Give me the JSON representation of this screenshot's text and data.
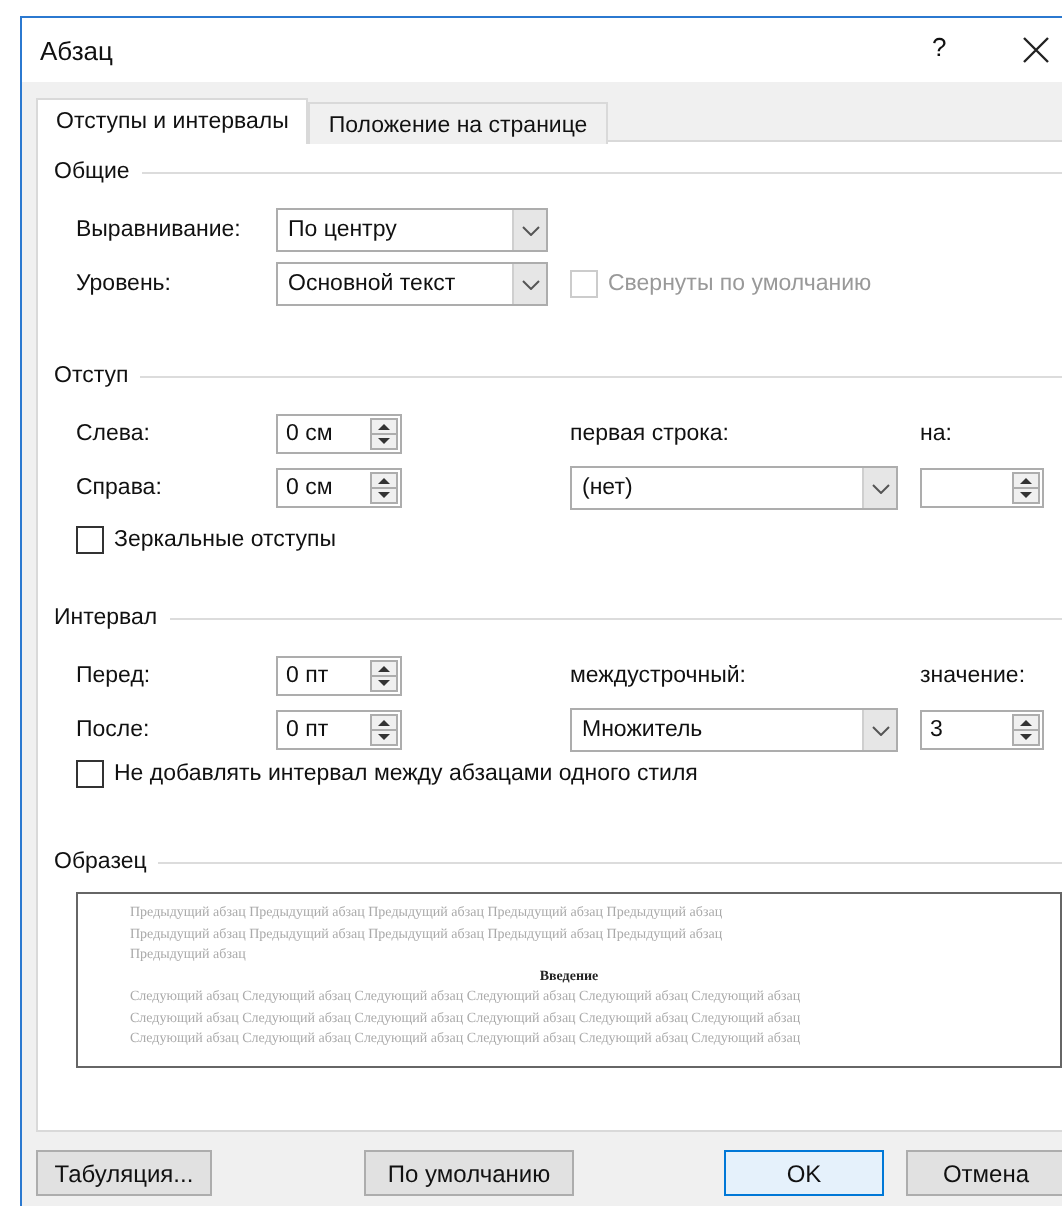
{
  "window": {
    "title": "Абзац",
    "help": "?"
  },
  "tabs": [
    {
      "label": "Отступы и интервалы",
      "selected": true
    },
    {
      "label": "Положение на странице",
      "selected": false
    }
  ],
  "general": {
    "title": "Общие",
    "alignment": {
      "label": "Выравнивание:",
      "value": "По центру"
    },
    "level": {
      "label": "Уровень:",
      "value": "Основной текст"
    },
    "collapsed": {
      "label": "Свернуты по умолчанию",
      "checked": false,
      "disabled": true
    }
  },
  "indent": {
    "title": "Отступ",
    "left": {
      "label": "Слева:",
      "value": "0 см"
    },
    "right": {
      "label": "Справа:",
      "value": "0 см"
    },
    "first_line": {
      "label": "первая строка:",
      "value": "(нет)"
    },
    "by": {
      "label": "на:"
    },
    "mirror": {
      "label": "Зеркальные отступы",
      "checked": false,
      "disabled": false
    }
  },
  "spacing": {
    "title": "Интервал",
    "before": {
      "label": "Перед:",
      "value": "0 пт"
    },
    "after": {
      "label": "После:",
      "value": "0 пт"
    },
    "line_spacing": {
      "label": "междустрочный:",
      "value": "Множитель"
    },
    "at": {
      "label": "значение:",
      "value": "3"
    },
    "dont_add": {
      "label": "Не добавлять интервал между абзацами одного стиля",
      "checked": false,
      "disabled": false
    }
  },
  "preview": {
    "title": "Образец",
    "previous_lines": [
      "Предыдущий абзац Предыдущий абзац Предыдущий абзац Предыдущий абзац Предыдущий абзац",
      "Предыдущий абзац Предыдущий абзац Предыдущий абзац Предыдущий абзац Предыдущий абзац",
      "Предыдущий абзац"
    ],
    "current": "Введение",
    "next_lines": [
      "Следующий абзац Следующий абзац Следующий абзац Следующий абзац Следующий абзац Следующий абзац",
      "Следующий абзац Следующий абзац Следующий абзац Следующий абзац Следующий абзац Следующий абзац",
      "Следующий абзац Следующий абзац Следующий абзац Следующий абзац Следующий абзац Следующий абзац"
    ]
  },
  "buttons": [
    {
      "label": "Табуляция...",
      "default": false
    },
    {
      "label": "По умолчанию",
      "default": false
    },
    {
      "label": "OK",
      "default": true
    },
    {
      "label": "Отмена",
      "default": false
    }
  ]
}
